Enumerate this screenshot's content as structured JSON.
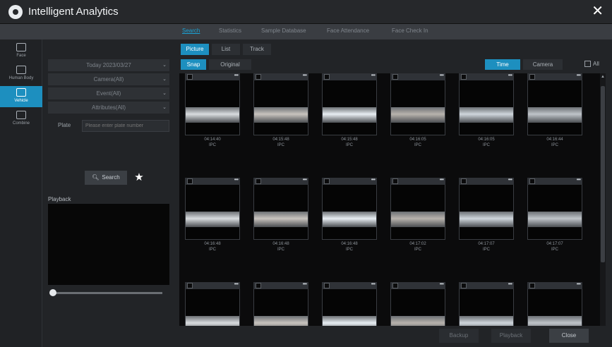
{
  "window": {
    "title": "Intelligent Analytics"
  },
  "topnav": {
    "tabs": [
      "Search",
      "Statistics",
      "Sample Database",
      "Face Attendance",
      "Face Check In"
    ],
    "active": 0
  },
  "leftbar": {
    "items": [
      {
        "label": "Face",
        "icon": "face-icon"
      },
      {
        "label": "Human Body",
        "icon": "human-body-icon"
      },
      {
        "label": "Vehicle",
        "icon": "vehicle-icon",
        "active": true
      },
      {
        "label": "Combine",
        "icon": "combine-icon"
      }
    ]
  },
  "filters": {
    "date": "Today 2023/03/27",
    "camera": "Camera(All)",
    "event": "Event(All)",
    "attributes": "Attributes(All)",
    "plate_label": "Plate",
    "plate_placeholder": "Please enter plate number",
    "search_label": "Search",
    "playback_label": "Playback"
  },
  "view_tabs": [
    "Picture",
    "List",
    "Track"
  ],
  "view_active": 0,
  "image_tabs": [
    "Snap",
    "Original"
  ],
  "image_active": 0,
  "sort_tabs": [
    "Time",
    "Camera"
  ],
  "sort_active": 0,
  "all_label": "All",
  "results": [
    {
      "time": "04:14:40",
      "source": "IPC"
    },
    {
      "time": "04:15:48",
      "source": "IPC"
    },
    {
      "time": "04:15:48",
      "source": "IPC"
    },
    {
      "time": "04:16:05",
      "source": "IPC"
    },
    {
      "time": "04:16:05",
      "source": "IPC"
    },
    {
      "time": "04:16:44",
      "source": "IPC"
    },
    {
      "time": "04:16:48",
      "source": "IPC"
    },
    {
      "time": "04:16:48",
      "source": "IPC"
    },
    {
      "time": "04:16:48",
      "source": "IPC"
    },
    {
      "time": "04:17:02",
      "source": "IPC"
    },
    {
      "time": "04:17:07",
      "source": "IPC"
    },
    {
      "time": "04:17:07",
      "source": "IPC"
    },
    {
      "time": "",
      "source": ""
    },
    {
      "time": "",
      "source": ""
    },
    {
      "time": "",
      "source": ""
    },
    {
      "time": "",
      "source": ""
    },
    {
      "time": "",
      "source": ""
    },
    {
      "time": "",
      "source": ""
    }
  ],
  "footer": {
    "buttons": [
      "Backup",
      "Playback",
      "Close"
    ]
  },
  "colors": {
    "accent": "#1d8fbf",
    "background": "#1b1c1e"
  }
}
